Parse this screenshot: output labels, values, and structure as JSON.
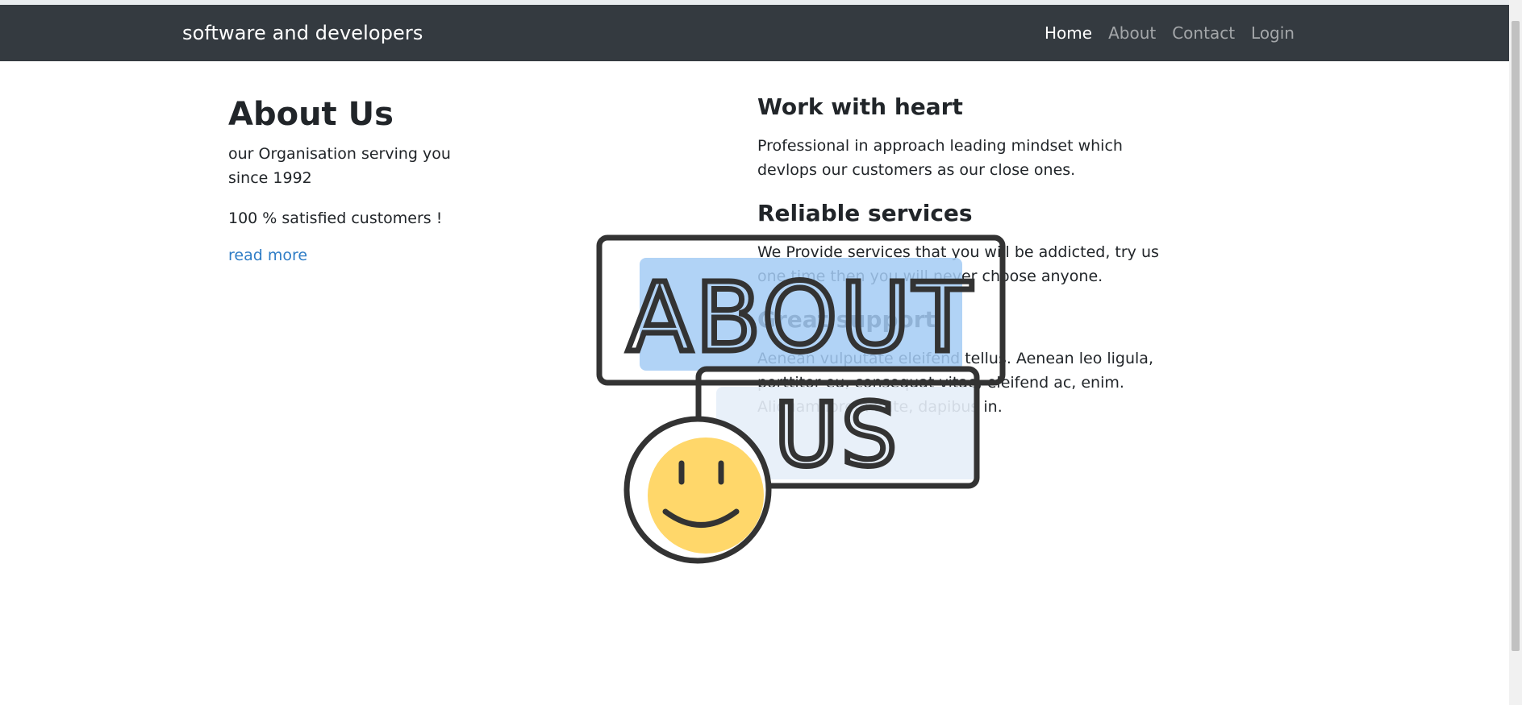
{
  "navbar": {
    "brand": "software and developers",
    "links": [
      {
        "label": "Home",
        "active": true
      },
      {
        "label": "About",
        "active": false
      },
      {
        "label": "Contact",
        "active": false
      },
      {
        "label": "Login",
        "active": false
      }
    ]
  },
  "about": {
    "title": "About Us",
    "intro": "our Organisation serving you since 1992",
    "satisfaction": "100 % satisfied customers !",
    "read_more": "read more"
  },
  "features": [
    {
      "title": "Work with heart",
      "text": "Professional in approach leading mindset which devlops our customers as our close ones."
    },
    {
      "title": "Reliable services",
      "text": "We Provide services that you will be addicted, try us one time then you will never choose anyone."
    },
    {
      "title": "Great support",
      "text": "Aenean vulputate eleifend tellus. Aenean leo ligula, porttitor eu, consequat vitae, eleifend ac, enim. Aliquam lorem ante, dapibus in."
    }
  ],
  "illustration": {
    "word_top": "ABOUT",
    "word_bottom": "US",
    "colors": {
      "outline": "#333333",
      "top_fill": "#a3cbf5",
      "bottom_fill": "#e6eef8",
      "smiley": "#ffd76a"
    }
  },
  "colors": {
    "navbar": "#343a40",
    "link": "#2f7dc6"
  }
}
